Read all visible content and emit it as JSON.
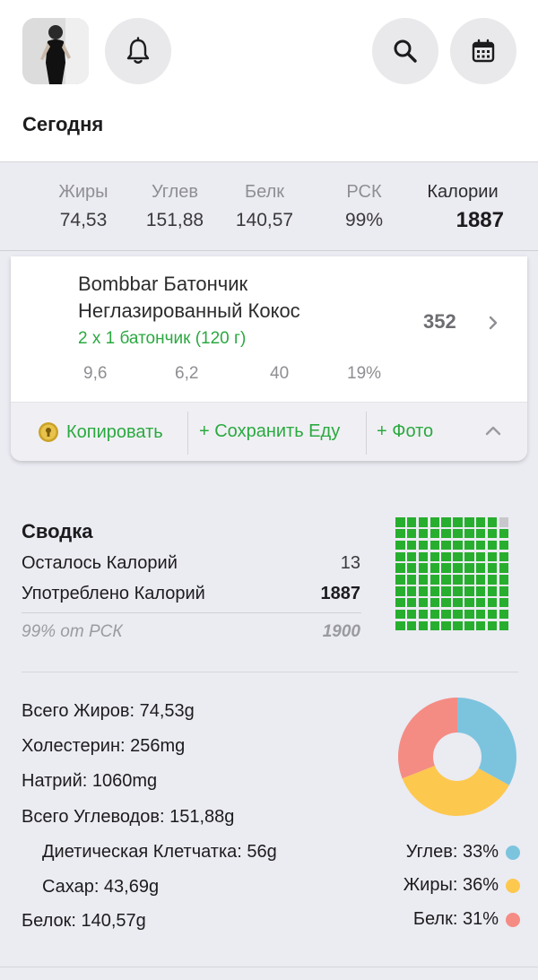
{
  "header": {
    "title": "Сегодня"
  },
  "totals": {
    "fat": {
      "label": "Жиры",
      "value": "74,53"
    },
    "carbs": {
      "label": "Углев",
      "value": "151,88"
    },
    "protein": {
      "label": "Белк",
      "value": "140,57"
    },
    "rsk": {
      "label": "РСК",
      "value": "99%"
    },
    "kcal": {
      "label": "Калории",
      "value": "1887"
    }
  },
  "food": {
    "name_line1": "Bombbar Батончик",
    "name_line2": "Неглазированный Кокос",
    "serving": "2 x 1 батончик (120 г)",
    "calories": "352",
    "fat": "9,6",
    "carbs": "6,2",
    "protein": "40",
    "rsk": "19%",
    "actions": {
      "copy": "Копировать",
      "save": "+ Сохранить Еду",
      "photo": "+ Фото"
    }
  },
  "summary": {
    "title": "Сводка",
    "remaining_label": "Осталось Калорий",
    "remaining_value": "13",
    "consumed_label": "Употреблено Калорий",
    "consumed_value": "1887",
    "rsk_label": "99% от РСК",
    "rsk_value": "1900",
    "progress_fraction": 0.99
  },
  "nutrients": {
    "total_fat": "Всего Жиров: 74,53g",
    "cholesterol": "Холестерин: 256mg",
    "sodium": "Натрий: 1060mg",
    "total_carbs": "Всего Углеводов: 151,88g",
    "fiber": "Диетическая Клетчатка: 56g",
    "sugar": "Сахар: 43,69g",
    "protein": "Белок: 140,57g"
  },
  "macro_split": {
    "carbs": {
      "label": "Углев: 33%",
      "percent": 33,
      "color": "#7cc4de"
    },
    "fat": {
      "label": "Жиры: 36%",
      "percent": 36,
      "color": "#fdc84e"
    },
    "protein": {
      "label": "Белк: 31%",
      "percent": 31,
      "color": "#f48c84"
    }
  },
  "colors": {
    "accent": "#2ba940",
    "grid_fill": "#27ae2e",
    "grid_empty": "#c8c8cc"
  },
  "icons": [
    "bell-icon",
    "search-icon",
    "calendar-icon",
    "chevron-right-icon",
    "chevron-up-icon",
    "copy-coin-icon"
  ]
}
